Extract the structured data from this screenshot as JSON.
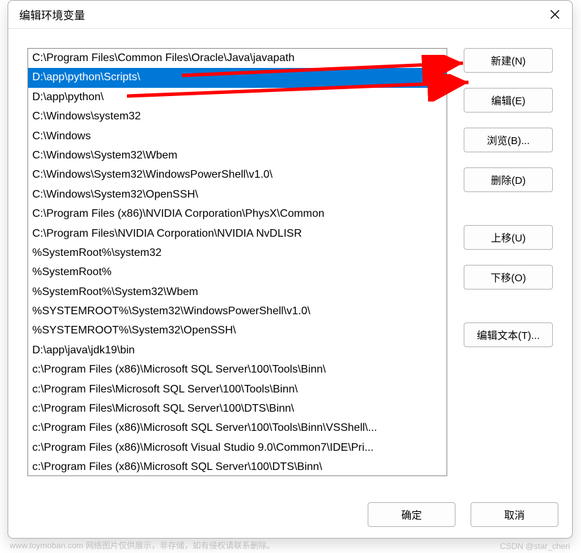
{
  "window": {
    "title": "编辑环境变量"
  },
  "list": {
    "items": [
      "C:\\Program Files\\Common Files\\Oracle\\Java\\javapath",
      "D:\\app\\python\\Scripts\\",
      "D:\\app\\python\\",
      "C:\\Windows\\system32",
      "C:\\Windows",
      "C:\\Windows\\System32\\Wbem",
      "C:\\Windows\\System32\\WindowsPowerShell\\v1.0\\",
      "C:\\Windows\\System32\\OpenSSH\\",
      "C:\\Program Files (x86)\\NVIDIA Corporation\\PhysX\\Common",
      "C:\\Program Files\\NVIDIA Corporation\\NVIDIA NvDLISR",
      "%SystemRoot%\\system32",
      "%SystemRoot%",
      "%SystemRoot%\\System32\\Wbem",
      "%SYSTEMROOT%\\System32\\WindowsPowerShell\\v1.0\\",
      "%SYSTEMROOT%\\System32\\OpenSSH\\",
      "D:\\app\\java\\jdk19\\bin",
      "c:\\Program Files (x86)\\Microsoft SQL Server\\100\\Tools\\Binn\\",
      "c:\\Program Files\\Microsoft SQL Server\\100\\Tools\\Binn\\",
      "c:\\Program Files\\Microsoft SQL Server\\100\\DTS\\Binn\\",
      "c:\\Program Files (x86)\\Microsoft SQL Server\\100\\Tools\\Binn\\VSShell\\...",
      "c:\\Program Files (x86)\\Microsoft Visual Studio 9.0\\Common7\\IDE\\Pri...",
      "c:\\Program Files (x86)\\Microsoft SQL Server\\100\\DTS\\Binn\\"
    ],
    "selected_index": 1
  },
  "buttons": {
    "new": "新建(N)",
    "edit": "编辑(E)",
    "browse": "浏览(B)...",
    "delete": "删除(D)",
    "moveup": "上移(U)",
    "movedown": "下移(O)",
    "edittext": "编辑文本(T)...",
    "ok": "确定",
    "cancel": "取消"
  },
  "watermark": {
    "left": "www.toymoban.com 网络图片仅供展示，非存储，如有侵权请联系删除。",
    "right": "CSDN @star_cheri"
  }
}
